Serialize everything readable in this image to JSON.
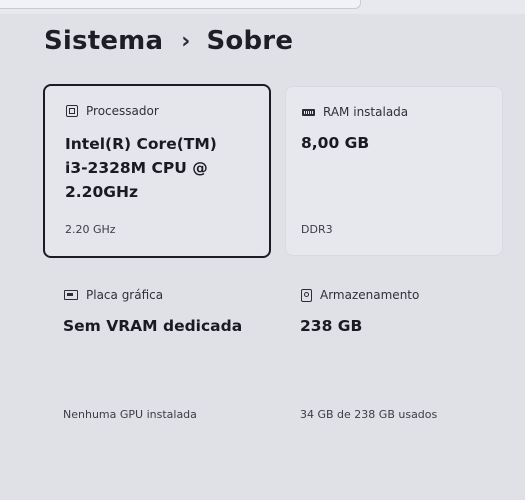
{
  "breadcrumb": {
    "parent": "Sistema",
    "separator": "›",
    "current": "Sobre"
  },
  "cards": {
    "processor": {
      "label": "Processador",
      "icon": "processor-icon",
      "value": "Intel(R) Core(TM) i3-2328M CPU @ 2.20GHz",
      "footer": "2.20 GHz"
    },
    "ram": {
      "label": "RAM instalada",
      "icon": "ram-icon",
      "value": "8,00 GB",
      "footer": "DDR3"
    },
    "gpu": {
      "label": "Placa gráfica",
      "icon": "graphics-card-icon",
      "value": "Sem VRAM dedicada",
      "footer": "Nenhuma GPU instalada"
    },
    "storage": {
      "label": "Armazenamento",
      "icon": "storage-icon",
      "value": "238 GB",
      "footer": "34 GB de 238 GB usados"
    }
  }
}
